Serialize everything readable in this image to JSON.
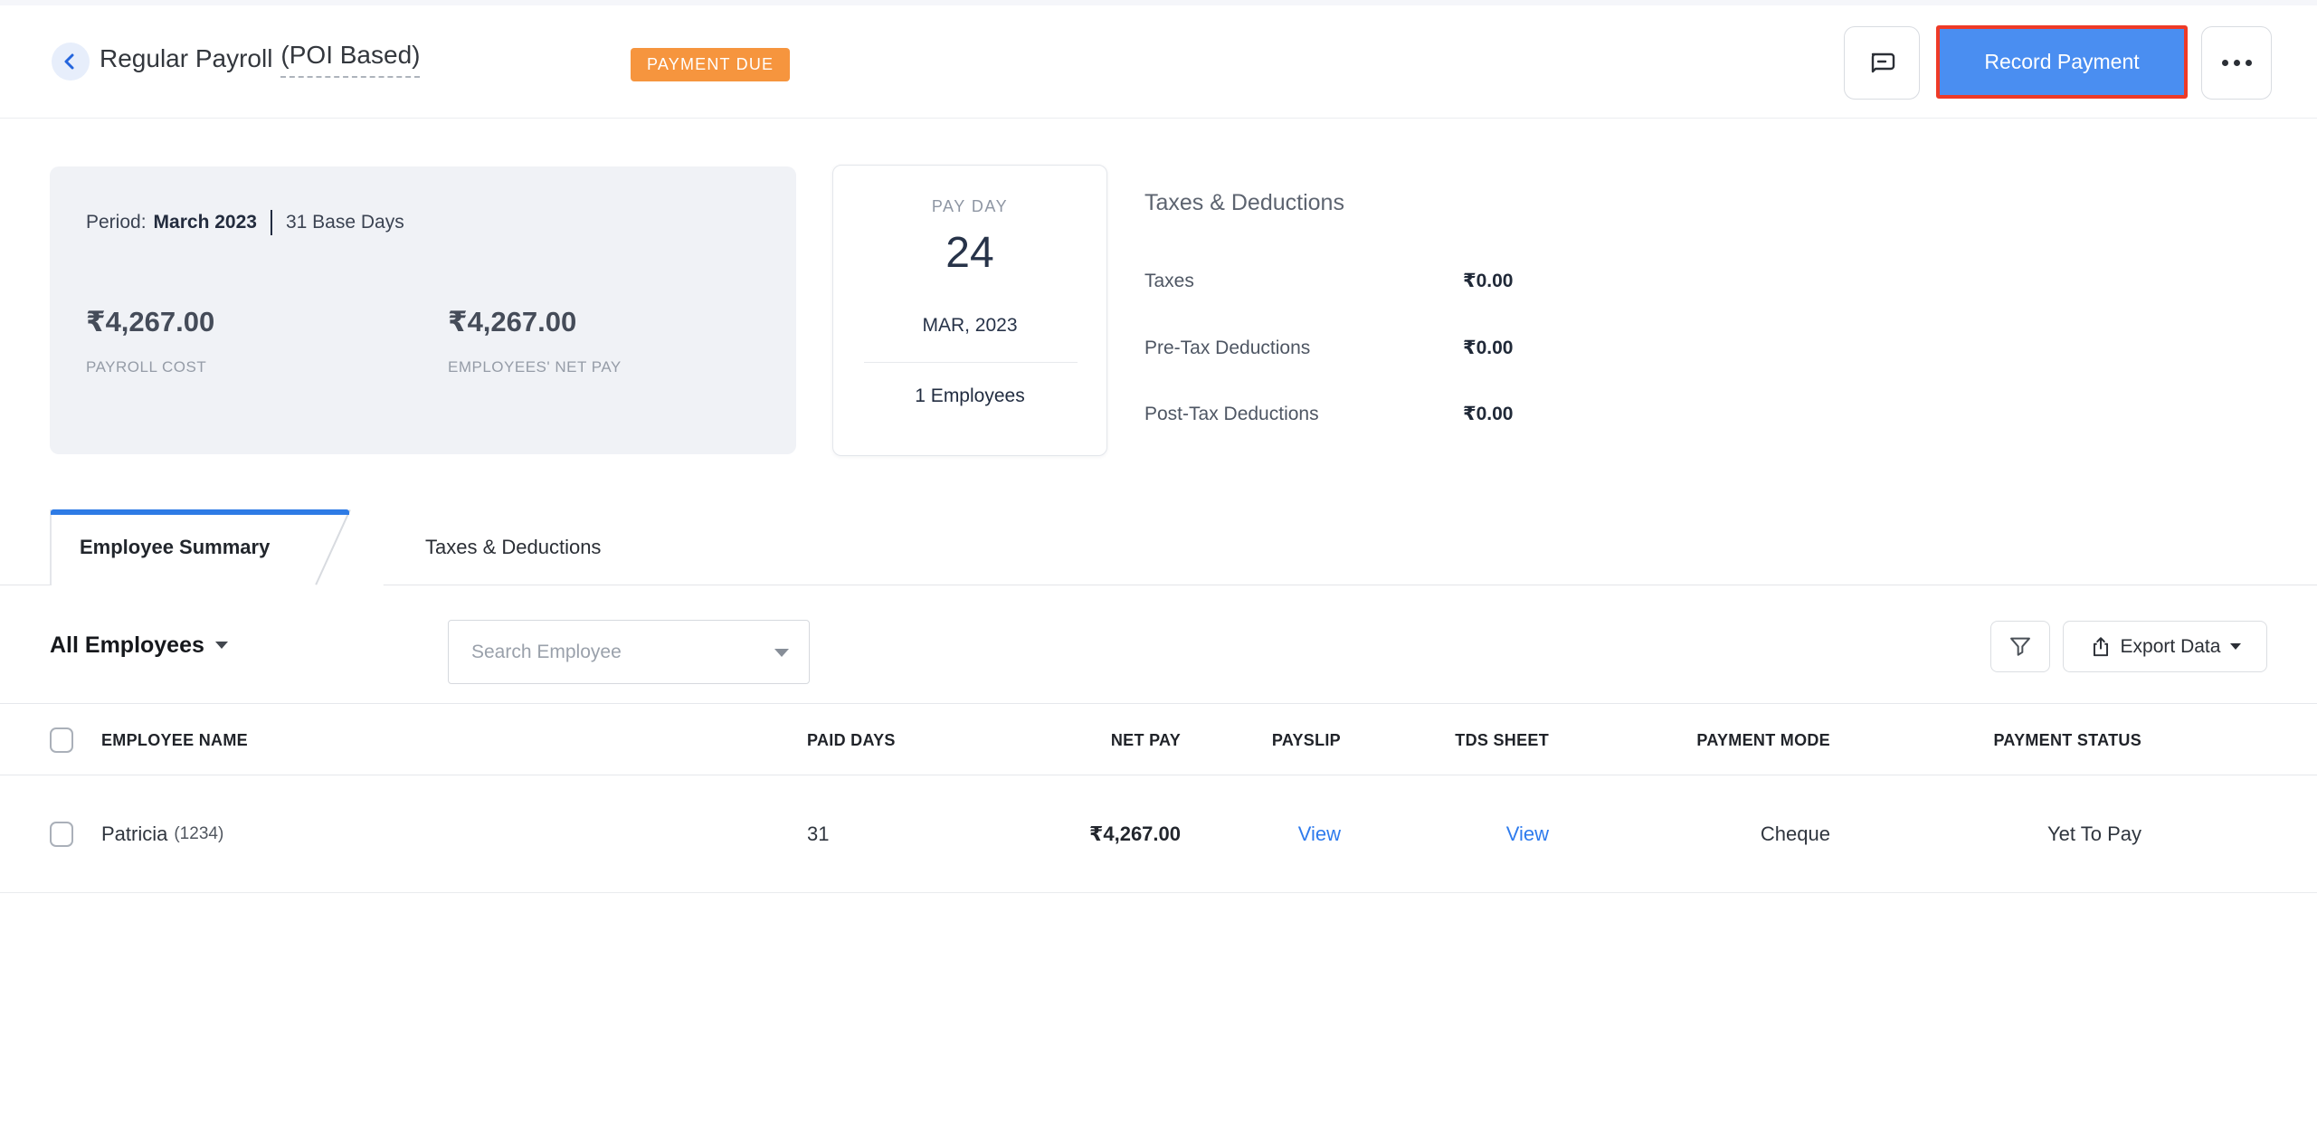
{
  "header": {
    "title_main": "Regular Payroll",
    "title_suffix": "(POI Based)",
    "status_badge": "PAYMENT DUE",
    "record_payment_label": "Record Payment"
  },
  "summary": {
    "period_label": "Period:",
    "period_value": "March 2023",
    "base_days": "31 Base Days",
    "payroll_cost": {
      "amount": "₹4,267.00",
      "label": "PAYROLL COST"
    },
    "net_pay": {
      "amount": "₹4,267.00",
      "label": "EMPLOYEES' NET PAY"
    }
  },
  "pay_day": {
    "label": "PAY DAY",
    "day": "24",
    "month_year": "MAR, 2023",
    "employees": "1 Employees"
  },
  "taxes_deductions": {
    "heading": "Taxes & Deductions",
    "rows": [
      {
        "label": "Taxes",
        "value": "₹0.00"
      },
      {
        "label": "Pre-Tax Deductions",
        "value": "₹0.00"
      },
      {
        "label": "Post-Tax Deductions",
        "value": "₹0.00"
      }
    ]
  },
  "tabs": [
    {
      "label": "Employee Summary",
      "active": true
    },
    {
      "label": "Taxes & Deductions",
      "active": false
    }
  ],
  "filters": {
    "employee_filter": "All Employees",
    "search_placeholder": "Search Employee",
    "export_label": "Export Data"
  },
  "table": {
    "columns": [
      "EMPLOYEE NAME",
      "PAID DAYS",
      "NET PAY",
      "PAYSLIP",
      "TDS SHEET",
      "PAYMENT MODE",
      "PAYMENT STATUS"
    ],
    "rows": [
      {
        "name": "Patricia",
        "id": "(1234)",
        "paid_days": "31",
        "net_pay": "₹4,267.00",
        "payslip": "View",
        "tds_sheet": "View",
        "payment_mode": "Cheque",
        "payment_status": "Yet To Pay"
      }
    ]
  },
  "colors": {
    "accent_blue": "#4a8ef1",
    "highlight_red": "#ee3a27",
    "badge_orange": "#f6953e",
    "link_blue": "#2e7bed",
    "tab_blue": "#2e7be5"
  }
}
